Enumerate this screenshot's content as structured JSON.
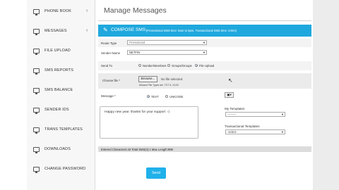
{
  "sidebar": {
    "items": [
      {
        "label": "PHONE BOOK",
        "chevron": "‹"
      },
      {
        "label": "MESSAGES",
        "chevron": "‹"
      },
      {
        "label": "FILE UPLOAD",
        "chevron": ""
      },
      {
        "label": "SMS REPORTS",
        "chevron": ""
      },
      {
        "label": "SMS BALANCE",
        "chevron": ""
      },
      {
        "label": "SENDER IDS",
        "chevron": ""
      },
      {
        "label": "TRANS TEMPLATES",
        "chevron": ""
      },
      {
        "label": "DOWNLOADS",
        "chevron": ""
      },
      {
        "label": "CHANGE PASSWORD",
        "chevron": ""
      }
    ]
  },
  "page": {
    "title": "Manage Messages"
  },
  "compose": {
    "title": "COMPOSE SMS",
    "note": "[Promotional SMS time: 9am to 9pm, Transactional SMS time: 24hrs]",
    "route_label": "Route Type",
    "route_value": "Promotional",
    "sender_label": "Sender Name",
    "sender_value": "NETFIN",
    "sendto_label": "Send To",
    "sendto_options": [
      "Number/Members",
      "Groups/Groups",
      "File Upload"
    ],
    "sendto_selected": "File Upload",
    "file_label": "Choose file *",
    "browse_label": "Browse...",
    "no_file_text": "No file selected.",
    "allowed_text": "Allowed File Types are .TXT & .XLSX",
    "message_label": "Message *",
    "message_type_options": [
      "TEXT",
      "UNICODE"
    ],
    "message_type_selected": "TEXT",
    "message_text": "Happy new year. thanks for your support :-)",
    "templates_label": "My Templates",
    "templates_value": "---------",
    "trans_templates_label": "Transactional Templates",
    "trans_templates_value": "-select-",
    "count_text": "Entered Characters:43 Total SMS(s):1 Max Length:999",
    "send_label": "Send"
  },
  "icons": {
    "compose": "pencil-icon",
    "sidebar": "monitor-icon",
    "paste": "clipboard-icon",
    "cursor": "mouse-cursor-icon"
  },
  "colors": {
    "accent": "#1fa8dd",
    "send_button": "#1fb1ea",
    "count_highlight": "#cc0000"
  }
}
